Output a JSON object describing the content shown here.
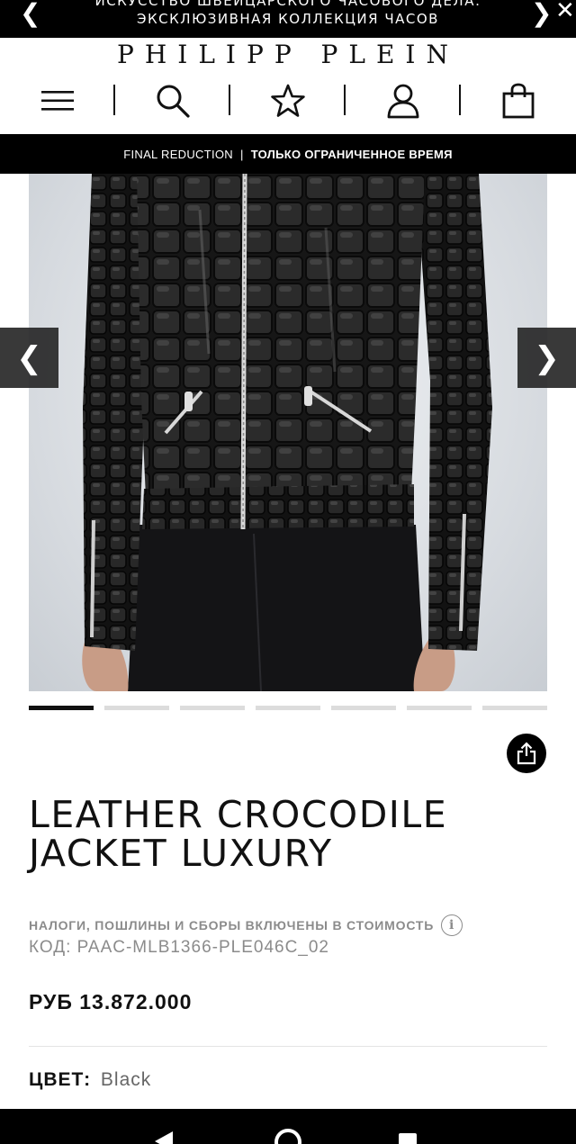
{
  "promo": {
    "line1": "ИСКУССТВО ШВЕЙЦАРСКОГО ЧАСОВОГО ДЕЛА:",
    "line2": "ЭКСКЛЮЗИВНАЯ КОЛЛЕКЦИЯ ЧАСОВ",
    "prev_glyph": "❮",
    "next_glyph": "❯",
    "close_glyph": "✕"
  },
  "header": {
    "logo": "PHILIPP PLEIN",
    "icons": [
      "menu-icon",
      "search-icon",
      "star-icon",
      "user-icon",
      "bag-icon"
    ]
  },
  "reduction": {
    "left": "FINAL REDUCTION",
    "separator": "|",
    "right": "ТОЛЬКО ОГРАНИЧЕННОЕ ВРЕМЯ"
  },
  "gallery": {
    "prev_glyph": "❮",
    "next_glyph": "❯",
    "slide_count": 7,
    "active_slide": 1
  },
  "product": {
    "title_line1": "LEATHER CROCODILE",
    "title_line2": "JACKET LUXURY",
    "tax_note": "НАЛОГИ, ПОШЛИНЫ И СБОРЫ ВКЛЮЧЕНЫ В СТОИМОСТЬ",
    "info_glyph": "i",
    "code": "КОД: PAAC-MLB1366-PLE046C_02",
    "price": "РУБ 13.872.000",
    "color_label": "ЦВЕТ:",
    "color_value": "Black"
  },
  "colors": {
    "black": "#000000",
    "muted": "#8b8b8b",
    "inactive_dot": "#dcdcdc"
  }
}
